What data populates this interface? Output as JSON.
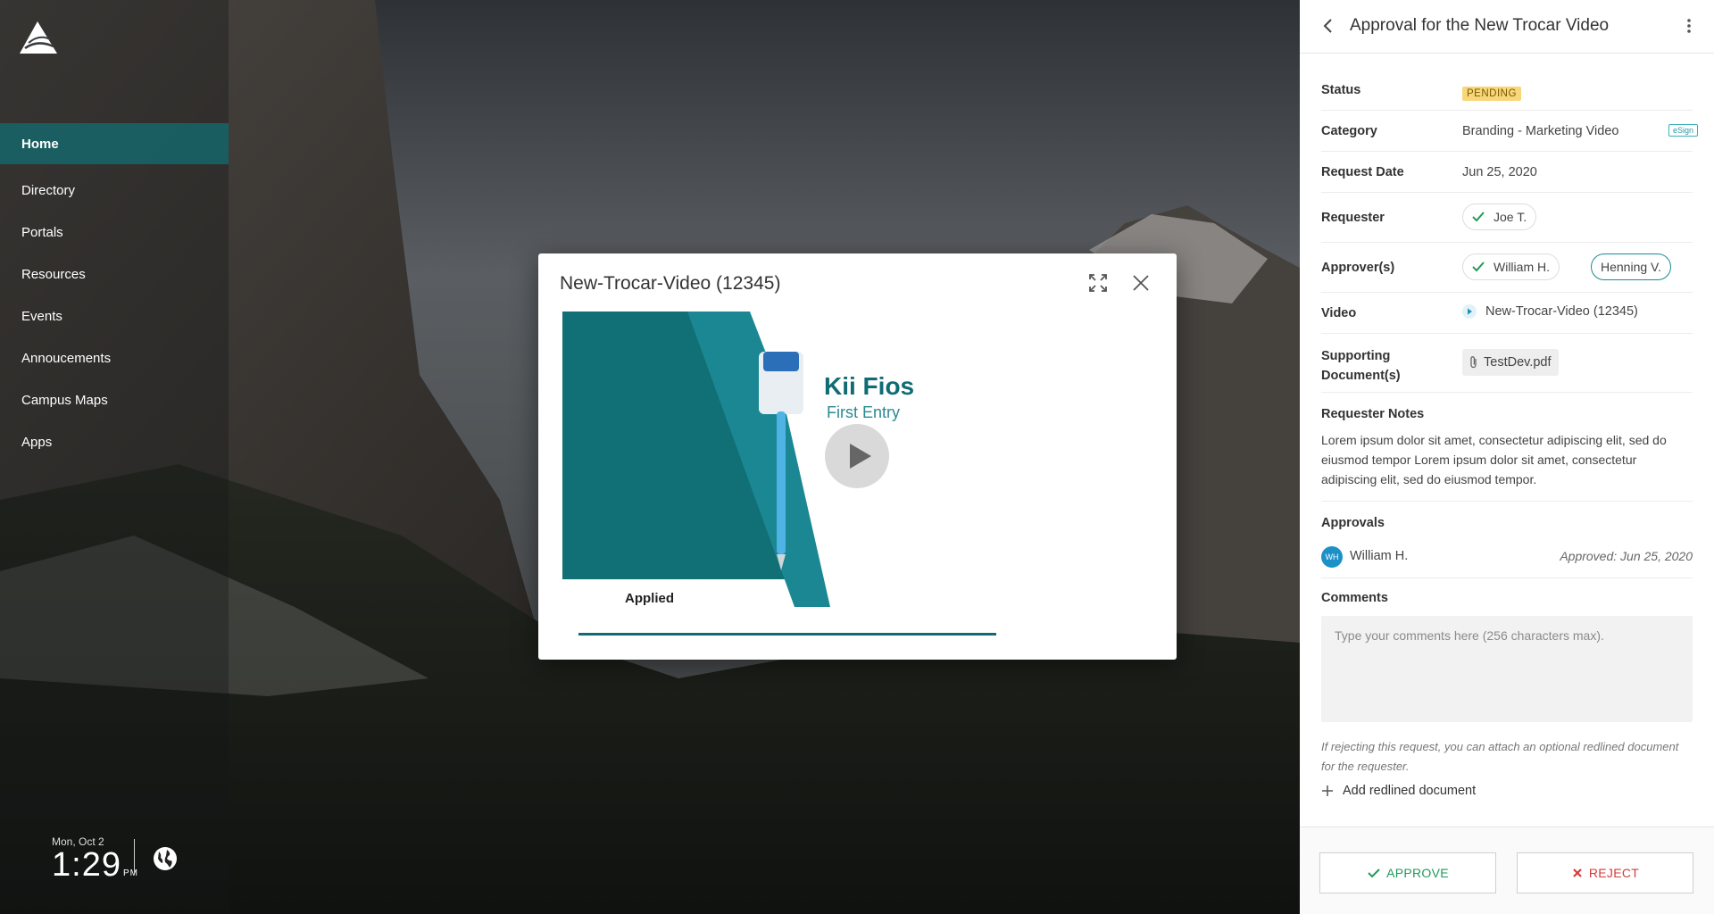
{
  "sidebar": {
    "items": [
      {
        "label": "Home",
        "active": true
      },
      {
        "label": "Directory"
      },
      {
        "label": "Portals"
      },
      {
        "label": "Resources"
      },
      {
        "label": "Events"
      },
      {
        "label": "Annoucements"
      },
      {
        "label": "Campus Maps"
      },
      {
        "label": "Apps"
      }
    ],
    "clock": {
      "date": "Mon, Oct 2",
      "time": "1:29",
      "ampm": "PM"
    },
    "icons": [
      "logo-mountain",
      "globe-icon"
    ]
  },
  "modal": {
    "title": "New-Trocar-Video (12345)",
    "video": {
      "product_name": "Kii Fios",
      "product_sub": "First Entry",
      "brand": "Applied"
    },
    "icons": [
      "expand-icon",
      "close-icon",
      "play-icon"
    ]
  },
  "panel": {
    "title": "Approval for the New Trocar Video",
    "fields": {
      "status": {
        "label": "Status",
        "value": "PENDING"
      },
      "category": {
        "label": "Category",
        "value": "Branding - Marketing Video",
        "tag": "eSign"
      },
      "request_date": {
        "label": "Request Date",
        "value": "Jun 25, 2020"
      },
      "requester": {
        "label": "Requester",
        "value": "Joe T."
      },
      "approvers": {
        "label": "Approver(s)",
        "values": [
          "William H.",
          "Henning V."
        ]
      },
      "video": {
        "label": "Video",
        "value": "New-Trocar-Video (12345)"
      },
      "supporting": {
        "label": "Supporting Document(s)",
        "value": "TestDev.pdf"
      }
    },
    "notes": {
      "label": "Requester Notes",
      "text": "Lorem ipsum dolor sit amet, consectetur adipiscing elit, sed do eiusmod tempor Lorem ipsum dolor sit amet, consectetur adipiscing elit, sed do eiusmod tempor."
    },
    "approvals": {
      "label": "Approvals",
      "items": [
        {
          "initials": "WH",
          "name": "William H.",
          "date": "Approved: Jun 25, 2020"
        }
      ]
    },
    "comments": {
      "label": "Comments",
      "placeholder": "Type your comments here (256 characters max).",
      "hint": "If rejecting this request, you can attach an optional redlined document for the requester.",
      "add_doc": "Add redlined document"
    },
    "actions": {
      "approve": "APPROVE",
      "reject": "REJECT"
    }
  },
  "colors": {
    "accent": "#0f6c74",
    "pending": "#f8d77a",
    "approve": "#1f9a5a",
    "reject": "#d83a3a",
    "avatar": "#1e90c8"
  }
}
